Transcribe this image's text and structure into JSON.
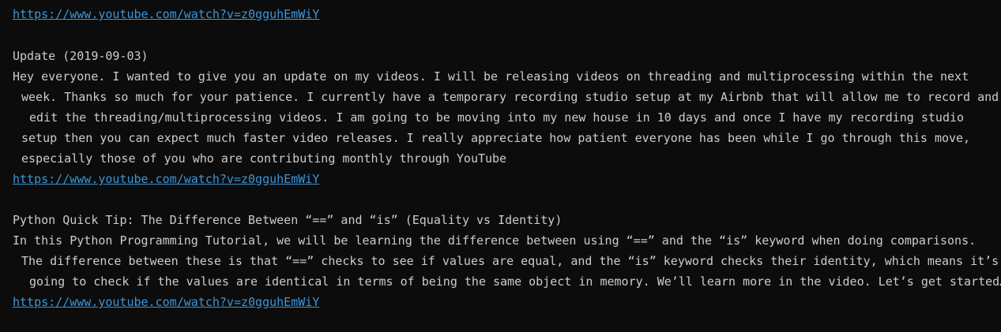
{
  "entries": [
    {
      "link": "https://www.youtube.com/watch?v=z0gguhEmWiY"
    },
    {
      "title": "Update (2019-09-03)",
      "description_lines": [
        "Hey everyone. I wanted to give you an update on my videos. I will be releasing videos on threading and multiprocessing within the next",
        "week. Thanks so much for your patience. I currently have a temporary recording studio setup at my Airbnb that will allow me to record and",
        "edit the threading/multiprocessing videos. I am going to be moving into my new house in 10 days and once I have my recording studio",
        "setup then you can expect much faster video releases. I really appreciate how patient everyone has been while I go through this move,",
        "especially those of you who are contributing monthly through YouTube"
      ],
      "link": "https://www.youtube.com/watch?v=z0gguhEmWiY"
    },
    {
      "title": "Python Quick Tip: The Difference Between “==” and “is” (Equality vs Identity)",
      "description_lines": [
        "In this Python Programming Tutorial, we will be learning the difference between using “==” and the “is” keyword when doing comparisons.",
        "The difference between these is that “==” checks to see if values are equal, and the “is” keyword checks their identity, which means it’s",
        "going to check if the values are identical in terms of being the same object in memory. We’ll learn more in the video. Let’s get started…"
      ],
      "link": "https://www.youtube.com/watch?v=z0gguhEmWiY"
    }
  ],
  "colors": {
    "background": "#0c0c0c",
    "text": "#cccccc",
    "link": "#3a96dd"
  }
}
